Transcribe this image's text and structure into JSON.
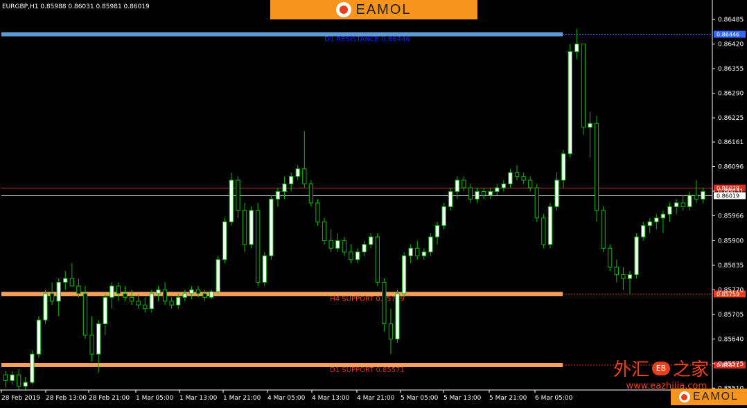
{
  "symbol_info": "EURGBP,H1  0.85988 0.86031 0.85981 0.86019",
  "brand": {
    "name": "EAMOL",
    "cn_name_a": "外汇",
    "cn_badge": "EB",
    "cn_name_b": "之家",
    "url": "www.eazhijia.com",
    "accent": "#f7941d",
    "red": "#e8401c"
  },
  "colors": {
    "bull_body": "#ffffff",
    "bear_body": "#000000",
    "candle_outline": "#00c000",
    "grid": "#000000",
    "axis": "#ffffff"
  },
  "chart_data": {
    "type": "candlestick",
    "title": "",
    "ylim": [
      0.85505,
      0.86522
    ],
    "y_ticks": [
      "0.86485",
      "0.86420",
      "0.86355",
      "0.86290",
      "0.86225",
      "0.86161",
      "0.86096",
      "0.86031",
      "0.85966",
      "0.85900",
      "0.85835",
      "0.85770",
      "0.85705",
      "0.85640",
      "0.85575",
      "0.85510"
    ],
    "x_ticks": [
      "28 Feb 2019",
      "28 Feb 13:00",
      "28 Feb 21:00",
      "1 Mar 05:00",
      "1 Mar 13:00",
      "1 Mar 21:00",
      "4 Mar 05:00",
      "4 Mar 13:00",
      "4 Mar 21:00",
      "5 Mar 05:00",
      "5 Mar 13:00",
      "5 Mar 21:00",
      "6 Mar 05:00"
    ],
    "levels": [
      {
        "label": "D1 RESISTANCE 0.86446",
        "value": 0.86446,
        "price_tag": "0.86446",
        "color": "#5b9bd5",
        "text_color": "#1a1aff",
        "tag_bg": "#3366ff"
      },
      {
        "label": "",
        "value": 0.86039,
        "price_tag": "0.86039",
        "color": "#c0392b",
        "text_color": "#c0392b",
        "tag_bg": "#d62d20"
      },
      {
        "label": "",
        "value": 0.86019,
        "price_tag": "0.86019",
        "color": "#bfbfbf",
        "text_color": "#000000",
        "tag_bg": "#ffffff"
      },
      {
        "label": "H4 SUPPORT 0.85759",
        "value": 0.85759,
        "price_tag": "0.85759",
        "color": "#f7a25a",
        "text_color": "#e8401c",
        "tag_bg": "#e8401c"
      },
      {
        "label": "D1 SUPPORT 0.85571",
        "value": 0.85571,
        "price_tag": "0.85571",
        "color": "#f7a25a",
        "text_color": "#d62d20",
        "tag_bg": "#d62d20"
      }
    ],
    "candles": [
      [
        0.85545,
        0.85555,
        0.85512,
        0.8553
      ],
      [
        0.8553,
        0.85555,
        0.8552,
        0.85545
      ],
      [
        0.85545,
        0.8556,
        0.85505,
        0.85515
      ],
      [
        0.85515,
        0.8554,
        0.85505,
        0.85525
      ],
      [
        0.85525,
        0.8561,
        0.8552,
        0.856
      ],
      [
        0.856,
        0.857,
        0.8559,
        0.8569
      ],
      [
        0.8569,
        0.8577,
        0.8568,
        0.8576
      ],
      [
        0.8576,
        0.8579,
        0.8573,
        0.8574
      ],
      [
        0.8574,
        0.858,
        0.857,
        0.8579
      ],
      [
        0.8579,
        0.8582,
        0.8577,
        0.858
      ],
      [
        0.858,
        0.8584,
        0.8578,
        0.8578
      ],
      [
        0.8578,
        0.858,
        0.8575,
        0.8576
      ],
      [
        0.8576,
        0.8578,
        0.8564,
        0.8565
      ],
      [
        0.8565,
        0.857,
        0.8558,
        0.856
      ],
      [
        0.856,
        0.8569,
        0.8555,
        0.8568
      ],
      [
        0.8568,
        0.8576,
        0.8565,
        0.8575
      ],
      [
        0.8575,
        0.8579,
        0.8572,
        0.8578
      ],
      [
        0.8578,
        0.8579,
        0.8574,
        0.8576
      ],
      [
        0.8576,
        0.8578,
        0.8574,
        0.8575
      ],
      [
        0.8575,
        0.8577,
        0.8573,
        0.8574
      ],
      [
        0.8574,
        0.8576,
        0.8572,
        0.8573
      ],
      [
        0.8573,
        0.8575,
        0.8571,
        0.8572
      ],
      [
        0.8572,
        0.8577,
        0.8571,
        0.8576
      ],
      [
        0.8576,
        0.8578,
        0.8574,
        0.8577
      ],
      [
        0.8577,
        0.8579,
        0.8573,
        0.8574
      ],
      [
        0.8574,
        0.8575,
        0.8572,
        0.8573
      ],
      [
        0.8573,
        0.8576,
        0.8572,
        0.8575
      ],
      [
        0.8575,
        0.8577,
        0.8574,
        0.8576
      ],
      [
        0.8576,
        0.8578,
        0.85745,
        0.8577
      ],
      [
        0.8577,
        0.8578,
        0.8575,
        0.8576
      ],
      [
        0.8576,
        0.8577,
        0.8574,
        0.8575
      ],
      [
        0.8575,
        0.8577,
        0.85745,
        0.85765
      ],
      [
        0.85765,
        0.8586,
        0.8576,
        0.8585
      ],
      [
        0.8585,
        0.8596,
        0.8584,
        0.8595
      ],
      [
        0.8595,
        0.8608,
        0.8594,
        0.8606
      ],
      [
        0.8606,
        0.8607,
        0.8596,
        0.8598
      ],
      [
        0.8598,
        0.86,
        0.8587,
        0.8589
      ],
      [
        0.8589,
        0.8599,
        0.8588,
        0.8598
      ],
      [
        0.8598,
        0.86,
        0.8578,
        0.8579
      ],
      [
        0.8579,
        0.8587,
        0.8578,
        0.8586
      ],
      [
        0.8586,
        0.8602,
        0.8585,
        0.8601
      ],
      [
        0.8601,
        0.8604,
        0.8599,
        0.8603
      ],
      [
        0.8603,
        0.8607,
        0.8601,
        0.8605
      ],
      [
        0.8605,
        0.8608,
        0.8603,
        0.8607
      ],
      [
        0.8607,
        0.861,
        0.8606,
        0.8609
      ],
      [
        0.8609,
        0.8619,
        0.8604,
        0.8605
      ],
      [
        0.8605,
        0.8606,
        0.8599,
        0.86
      ],
      [
        0.86,
        0.8601,
        0.8594,
        0.8595
      ],
      [
        0.8595,
        0.8596,
        0.8589,
        0.859
      ],
      [
        0.859,
        0.8593,
        0.8587,
        0.8588
      ],
      [
        0.8588,
        0.8592,
        0.8587,
        0.859
      ],
      [
        0.859,
        0.8591,
        0.8586,
        0.8587
      ],
      [
        0.8587,
        0.8589,
        0.8584,
        0.8585
      ],
      [
        0.8585,
        0.8588,
        0.8584,
        0.8587
      ],
      [
        0.8587,
        0.859,
        0.8586,
        0.8589
      ],
      [
        0.8589,
        0.8592,
        0.8588,
        0.8591
      ],
      [
        0.8591,
        0.8592,
        0.8578,
        0.8579
      ],
      [
        0.8579,
        0.858,
        0.8566,
        0.8568
      ],
      [
        0.8568,
        0.8572,
        0.856,
        0.8564
      ],
      [
        0.8564,
        0.8577,
        0.8563,
        0.8576
      ],
      [
        0.8576,
        0.8587,
        0.8575,
        0.8586
      ],
      [
        0.8586,
        0.8589,
        0.8584,
        0.8588
      ],
      [
        0.8588,
        0.859,
        0.8585,
        0.8586
      ],
      [
        0.8586,
        0.8588,
        0.8585,
        0.8587
      ],
      [
        0.8587,
        0.8592,
        0.8586,
        0.8591
      ],
      [
        0.8591,
        0.8595,
        0.8589,
        0.8594
      ],
      [
        0.8594,
        0.86,
        0.8593,
        0.8599
      ],
      [
        0.8599,
        0.8604,
        0.8598,
        0.8603
      ],
      [
        0.8603,
        0.8607,
        0.8601,
        0.8606
      ],
      [
        0.8606,
        0.8607,
        0.8603,
        0.8604
      ],
      [
        0.8604,
        0.8605,
        0.86,
        0.8601
      ],
      [
        0.8601,
        0.8604,
        0.86,
        0.8603
      ],
      [
        0.8603,
        0.8604,
        0.8601,
        0.8602
      ],
      [
        0.8602,
        0.8604,
        0.8601,
        0.8603
      ],
      [
        0.8603,
        0.8605,
        0.8602,
        0.8604
      ],
      [
        0.8604,
        0.8606,
        0.8603,
        0.8605
      ],
      [
        0.8605,
        0.8609,
        0.8604,
        0.8608
      ],
      [
        0.8608,
        0.861,
        0.8606,
        0.8607
      ],
      [
        0.8607,
        0.8608,
        0.8605,
        0.8606
      ],
      [
        0.8606,
        0.8607,
        0.8603,
        0.8604
      ],
      [
        0.8604,
        0.8605,
        0.8595,
        0.8596
      ],
      [
        0.8596,
        0.8597,
        0.8588,
        0.8589
      ],
      [
        0.8589,
        0.86,
        0.8588,
        0.8599
      ],
      [
        0.8599,
        0.8608,
        0.8598,
        0.8606
      ],
      [
        0.8606,
        0.8614,
        0.8604,
        0.8613
      ],
      [
        0.8613,
        0.8642,
        0.8612,
        0.864
      ],
      [
        0.864,
        0.8646,
        0.8638,
        0.8642
      ],
      [
        0.8642,
        0.8642,
        0.8618,
        0.862
      ],
      [
        0.862,
        0.8624,
        0.8612,
        0.8621
      ],
      [
        0.8621,
        0.8623,
        0.8595,
        0.8598
      ],
      [
        0.8598,
        0.8599,
        0.8587,
        0.8588
      ],
      [
        0.8588,
        0.8589,
        0.8582,
        0.8583
      ],
      [
        0.8583,
        0.8585,
        0.8579,
        0.8581
      ],
      [
        0.8581,
        0.8583,
        0.8577,
        0.858
      ],
      [
        0.858,
        0.8582,
        0.8576,
        0.8581
      ],
      [
        0.8581,
        0.8592,
        0.858,
        0.8591
      ],
      [
        0.8591,
        0.8595,
        0.859,
        0.8594
      ],
      [
        0.8594,
        0.8596,
        0.8592,
        0.8595
      ],
      [
        0.8595,
        0.8597,
        0.8593,
        0.8596
      ],
      [
        0.8596,
        0.8598,
        0.8592,
        0.8597
      ],
      [
        0.8597,
        0.86,
        0.8595,
        0.8599
      ],
      [
        0.8599,
        0.8601,
        0.8597,
        0.86
      ],
      [
        0.86,
        0.8602,
        0.8598,
        0.8599
      ],
      [
        0.8599,
        0.8603,
        0.8598,
        0.8602
      ],
      [
        0.8602,
        0.8606,
        0.86,
        0.8601
      ],
      [
        0.8601,
        0.8604,
        0.86,
        0.8603
      ]
    ]
  }
}
